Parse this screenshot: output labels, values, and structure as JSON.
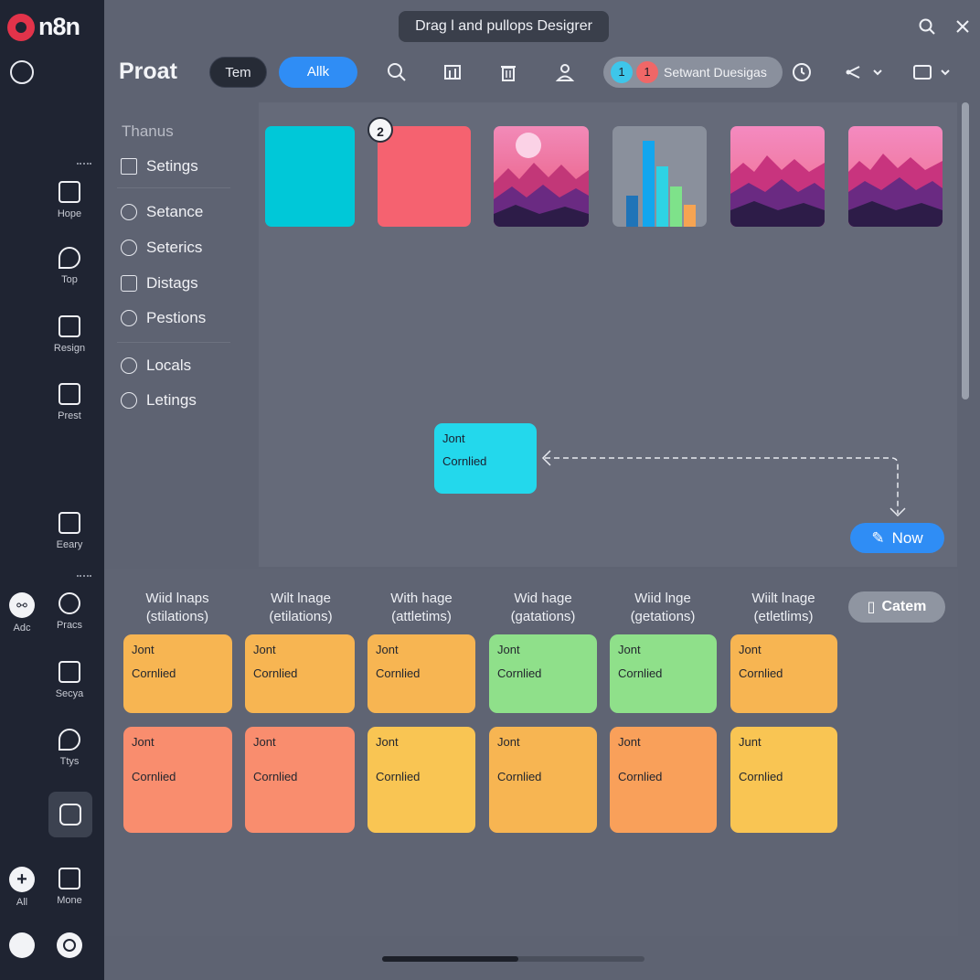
{
  "window": {
    "title": "Drag l and pullops Desigrer"
  },
  "brand": {
    "logo_text": "n8n"
  },
  "rail": {
    "items": [
      {
        "label": "Hope",
        "icon": "network-icon"
      },
      {
        "label": "Top",
        "icon": "pen-icon"
      },
      {
        "label": "Resign",
        "icon": "layers-icon"
      },
      {
        "label": "Prest",
        "icon": "image-icon"
      },
      {
        "label": "Eeary",
        "icon": "book-icon"
      },
      {
        "label": "Adc",
        "icon": "link-icon"
      },
      {
        "label": "Pracs",
        "icon": "compass-icon"
      },
      {
        "label": "Secya",
        "icon": "chart-icon"
      },
      {
        "label": "Ttys",
        "icon": "brush-icon"
      },
      {
        "label": "All",
        "icon": "plus-icon"
      },
      {
        "label": "Mone",
        "icon": "edit-icon"
      }
    ],
    "add_symbol": "+"
  },
  "header": {
    "app_title": "Proat",
    "tabs": [
      "Tem",
      "Allk"
    ],
    "users": {
      "counts": [
        "1",
        "1"
      ],
      "label": "Setwant Duesigas"
    }
  },
  "menu": {
    "heading": "Thanus",
    "items": [
      "Setings",
      "Setance",
      "Seterics",
      "Distags",
      "Pestions",
      "Locals",
      "Letings"
    ]
  },
  "canvas": {
    "thumbnail_badge": "2",
    "thumbnails": [
      {
        "kind": "solid",
        "color": "#00c8d8"
      },
      {
        "kind": "solid",
        "color": "#f56270"
      },
      {
        "kind": "landscape-sun"
      },
      {
        "kind": "bar-chart"
      },
      {
        "kind": "landscape"
      },
      {
        "kind": "landscape"
      }
    ],
    "node": {
      "line1": "Jont",
      "line2": "Cornlied"
    },
    "now_button": "Now"
  },
  "grid": {
    "columns": [
      [
        "Wiid lnaps",
        "(stilations)"
      ],
      [
        "Wilt lnage",
        "(etilations)"
      ],
      [
        "With hage",
        "(attletims)"
      ],
      [
        "Wid hage",
        "(gatations)"
      ],
      [
        "Wiid lnge",
        "(getations)"
      ],
      [
        "Wiilt lnage",
        "(etletlims)"
      ]
    ],
    "action_button": "Catem",
    "row1": [
      {
        "line1": "Jont",
        "line2": "Cornlied",
        "color": "#f7b552"
      },
      {
        "line1": "Jont",
        "line2": "Cornlied",
        "color": "#f7b552"
      },
      {
        "line1": "Jont",
        "line2": "Cornlied",
        "color": "#f7b552"
      },
      {
        "line1": "Jont",
        "line2": "Cornlied",
        "color": "#8fe08a"
      },
      {
        "line1": "Jont",
        "line2": "Cornlied",
        "color": "#8fe08a"
      },
      {
        "line1": "Jont",
        "line2": "Cornlied",
        "color": "#f7b552"
      }
    ],
    "row2": [
      {
        "line1": "Jont",
        "line2": "Cornlied",
        "color": "#f98d6e"
      },
      {
        "line1": "Jont",
        "line2": "Cornlied",
        "color": "#f98d6e"
      },
      {
        "line1": "Jont",
        "line2": "Cornlied",
        "color": "#f9c553"
      },
      {
        "line1": "Jont",
        "line2": "Cornlied",
        "color": "#f7b552"
      },
      {
        "line1": "Jont",
        "line2": "Cornlied",
        "color": "#f9a05a"
      },
      {
        "line1": "Junt",
        "line2": "Cornlied",
        "color": "#f9c553"
      }
    ]
  }
}
